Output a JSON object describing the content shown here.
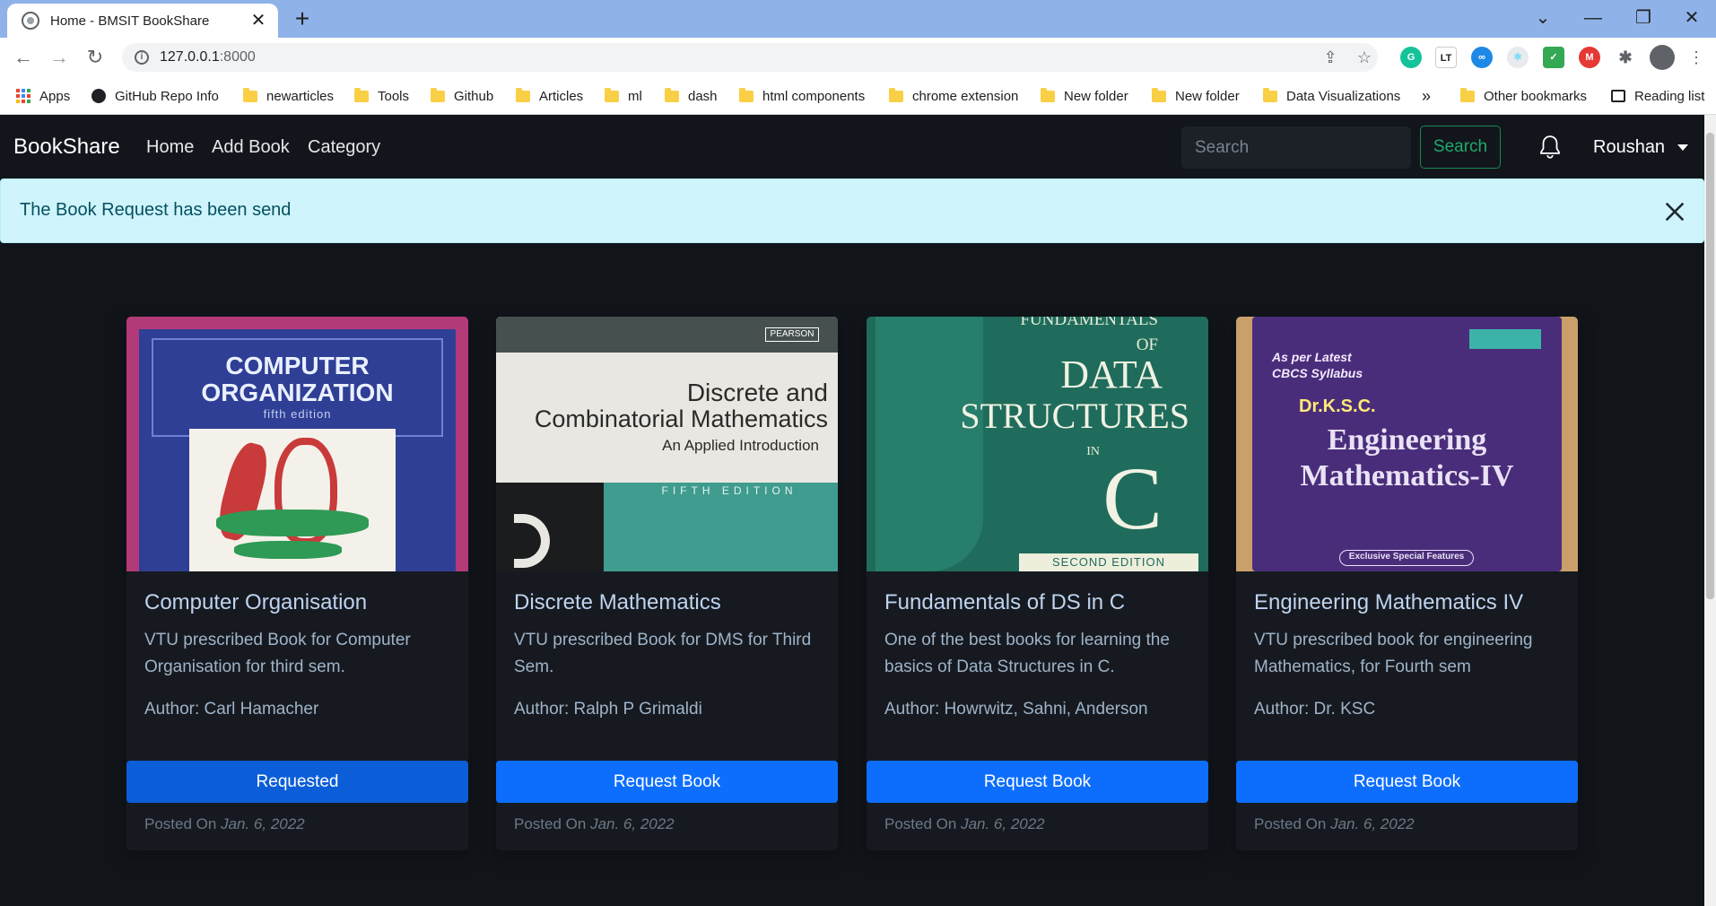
{
  "browser": {
    "tab_title": "Home - BMSIT BookShare",
    "url_host": "127.0.0.1",
    "url_port": ":8000",
    "bookmarks": [
      {
        "label": "Apps",
        "icon": "apps-grid-icon"
      },
      {
        "label": "GitHub Repo Info",
        "icon": "globe-icon"
      },
      {
        "label": "newarticles",
        "icon": "folder-icon"
      },
      {
        "label": "Tools",
        "icon": "folder-icon"
      },
      {
        "label": "Github",
        "icon": "folder-icon"
      },
      {
        "label": "Articles",
        "icon": "folder-icon"
      },
      {
        "label": "ml",
        "icon": "folder-icon"
      },
      {
        "label": "dash",
        "icon": "folder-icon"
      },
      {
        "label": "html components",
        "icon": "folder-icon"
      },
      {
        "label": "chrome extension",
        "icon": "folder-icon"
      },
      {
        "label": "New folder",
        "icon": "folder-icon"
      },
      {
        "label": "New folder",
        "icon": "folder-icon"
      },
      {
        "label": "Data Visualizations",
        "icon": "folder-icon"
      }
    ],
    "overflow": "»",
    "other_bookmarks": "Other bookmarks",
    "reading_list": "Reading list"
  },
  "navbar": {
    "brand": "BookShare",
    "links": [
      "Home",
      "Add Book",
      "Category"
    ],
    "search_placeholder": "Search",
    "search_button": "Search",
    "user": "Roushan"
  },
  "alert": {
    "message": "The Book Request has been send"
  },
  "books": [
    {
      "title": "Computer Organisation",
      "description": "VTU prescribed Book for Computer Organisation for third sem.",
      "author": "Author: Carl Hamacher",
      "button": "Requested",
      "posted_label": "Posted On",
      "posted_date": "Jan. 6, 2022",
      "cover_lines": [
        "COMPUTER",
        "ORGANIZATION",
        "fifth edition"
      ]
    },
    {
      "title": "Discrete Mathematics",
      "description": "VTU prescribed Book for DMS for Third Sem.",
      "author": "Author: Ralph P Grimaldi",
      "button": "Request Book",
      "posted_label": "Posted On",
      "posted_date": "Jan. 6, 2022",
      "cover_lines": [
        "Discrete and",
        "Combinatorial Mathematics",
        "An Applied Introduction",
        "FIFTH EDITION",
        "PEARSON"
      ]
    },
    {
      "title": "Fundamentals of DS in C",
      "description": "One of the best books for learning the basics of Data Structures in C.",
      "author": "Author: Howrwitz, Sahni, Anderson",
      "button": "Request Book",
      "posted_label": "Posted On",
      "posted_date": "Jan. 6, 2022",
      "cover_lines": [
        "FUNDAMENTALS",
        "OF",
        "DATA",
        "STRUCTURES",
        "IN",
        "C",
        "SECOND EDITION"
      ]
    },
    {
      "title": "Engineering Mathematics IV",
      "description": "VTU prescribed book for engineering Mathematics, for Fourth sem",
      "author": "Author: Dr. KSC",
      "button": "Request Book",
      "posted_label": "Posted On",
      "posted_date": "Jan. 6, 2022",
      "cover_lines": [
        "As per Latest",
        "CBCS Syllabus",
        "Dr.K.S.C.",
        "Engineering",
        "Mathematics-IV",
        "Exclusive Special Features"
      ]
    }
  ],
  "colors": {
    "primary": "#0d6efd",
    "success": "#198754",
    "alert_bg": "#cff4fc",
    "page_bg": "#11151a"
  }
}
